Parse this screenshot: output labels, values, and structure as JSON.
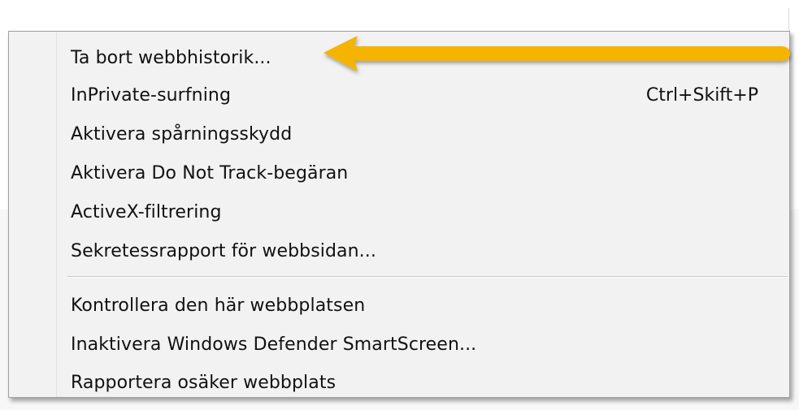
{
  "menu": {
    "items": [
      {
        "label": "Ta bort webbhistorik...",
        "shortcut": ""
      },
      {
        "label": "InPrivate-surfning",
        "shortcut": "Ctrl+Skift+P"
      },
      {
        "label": "Aktivera spårningsskydd",
        "shortcut": ""
      },
      {
        "label": "Aktivera Do Not Track-begäran",
        "shortcut": ""
      },
      {
        "label": "ActiveX-filtrering",
        "shortcut": ""
      },
      {
        "label": "Sekretessrapport för webbsidan...",
        "shortcut": ""
      },
      {
        "label": "Kontrollera den här webbplatsen",
        "shortcut": ""
      },
      {
        "label": "Inaktivera Windows Defender SmartScreen...",
        "shortcut": ""
      },
      {
        "label": "Rapportera osäker webbplats",
        "shortcut": ""
      }
    ]
  },
  "annotation": {
    "arrow_color": "#f5b400",
    "arrow_icon": "arrow-left-icon"
  }
}
